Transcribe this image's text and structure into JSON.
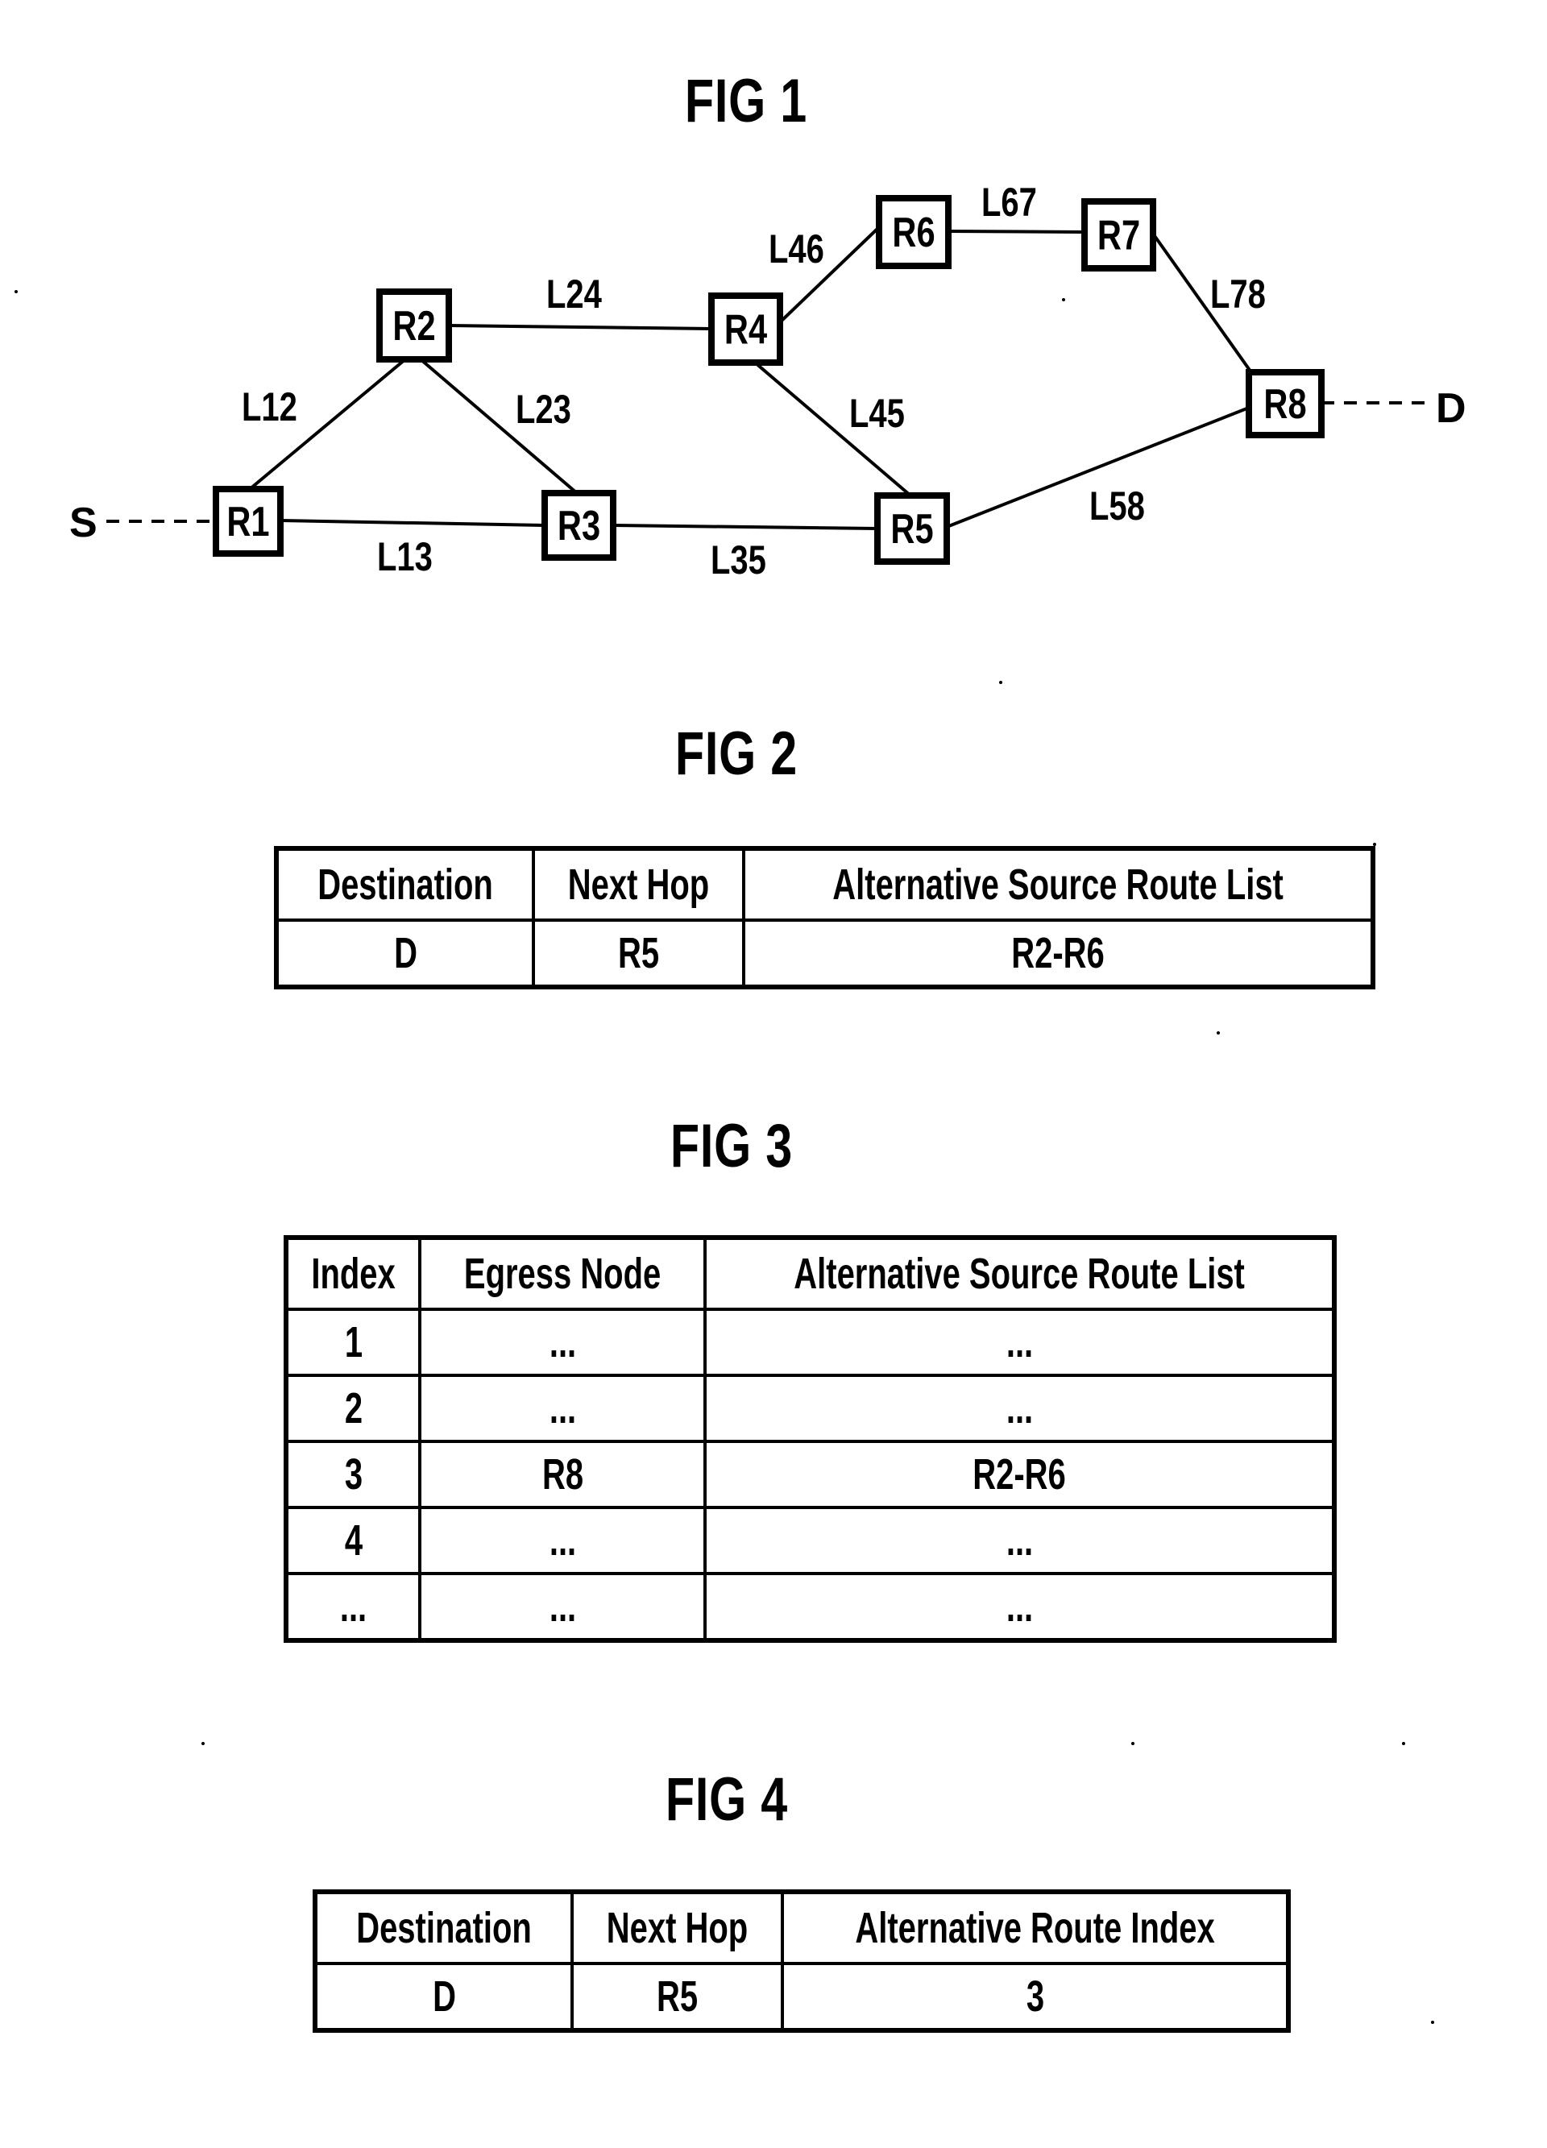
{
  "figures": {
    "fig1": {
      "title": "FIG 1",
      "source_label": "S",
      "destination_label": "D",
      "nodes": [
        {
          "id": "R1",
          "label": "R1"
        },
        {
          "id": "R2",
          "label": "R2"
        },
        {
          "id": "R3",
          "label": "R3"
        },
        {
          "id": "R4",
          "label": "R4"
        },
        {
          "id": "R5",
          "label": "R5"
        },
        {
          "id": "R6",
          "label": "R6"
        },
        {
          "id": "R7",
          "label": "R7"
        },
        {
          "id": "R8",
          "label": "R8"
        }
      ],
      "links": [
        {
          "label": "L12",
          "from": "R1",
          "to": "R2"
        },
        {
          "label": "L13",
          "from": "R1",
          "to": "R3"
        },
        {
          "label": "L23",
          "from": "R2",
          "to": "R3"
        },
        {
          "label": "L24",
          "from": "R2",
          "to": "R4"
        },
        {
          "label": "L35",
          "from": "R3",
          "to": "R5"
        },
        {
          "label": "L45",
          "from": "R4",
          "to": "R5"
        },
        {
          "label": "L46",
          "from": "R4",
          "to": "R6"
        },
        {
          "label": "L67",
          "from": "R6",
          "to": "R7"
        },
        {
          "label": "L78",
          "from": "R7",
          "to": "R8"
        },
        {
          "label": "L58",
          "from": "R5",
          "to": "R8"
        }
      ],
      "attachments": [
        {
          "from": "S",
          "to": "R1",
          "style": "dashed"
        },
        {
          "from": "R8",
          "to": "D",
          "style": "dashed"
        }
      ]
    },
    "fig2": {
      "title": "FIG 2",
      "headers": [
        "Destination",
        "Next Hop",
        "Alternative Source Route List"
      ],
      "rows": [
        [
          "D",
          "R5",
          "R2-R6"
        ]
      ]
    },
    "fig3": {
      "title": "FIG 3",
      "headers": [
        "Index",
        "Egress Node",
        "Alternative Source Route List"
      ],
      "rows": [
        [
          "1",
          "...",
          "..."
        ],
        [
          "2",
          "...",
          "..."
        ],
        [
          "3",
          "R8",
          "R2-R6"
        ],
        [
          "4",
          "...",
          "..."
        ],
        [
          "...",
          "...",
          "..."
        ]
      ]
    },
    "fig4": {
      "title": "FIG 4",
      "headers": [
        "Destination",
        "Next Hop",
        "Alternative Route Index"
      ],
      "rows": [
        [
          "D",
          "R5",
          "3"
        ]
      ]
    }
  }
}
